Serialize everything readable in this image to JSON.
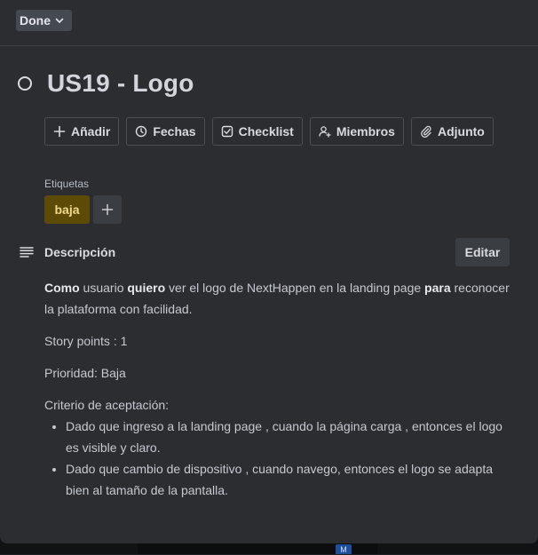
{
  "status": {
    "label": "Done"
  },
  "card": {
    "title": "US19 - Logo"
  },
  "actions": [
    {
      "label": "Añadir",
      "icon": "plus-icon"
    },
    {
      "label": "Fechas",
      "icon": "clock-icon"
    },
    {
      "label": "Checklist",
      "icon": "checkbox-icon"
    },
    {
      "label": "Miembros",
      "icon": "add-member-icon"
    },
    {
      "label": "Adjunto",
      "icon": "paperclip-icon"
    }
  ],
  "labels": {
    "heading": "Etiquetas",
    "items": [
      {
        "text": "baja",
        "color": "#5e4a07"
      }
    ]
  },
  "description": {
    "heading": "Descripción",
    "edit_label": "Editar",
    "intro": {
      "w1": "Como",
      "t1": " usuario ",
      "w2": "quiero",
      "t2": " ver el logo de NextHappen en la landing page ",
      "w3": "para",
      "t3": " reconocer la plataforma con facilidad."
    },
    "story_points": "Story points : 1",
    "priority": "Prioridad: Baja",
    "criteria_heading": "Criterio de aceptación:",
    "criteria": [
      "Dado que ingreso a la landing page , cuando la página carga , entonces el logo es visible y claro.",
      "Dado que cambio de dispositivo , cuando navego, entonces el logo se adapta bien al tamaño de la pantalla."
    ]
  },
  "backdrop": {
    "avatar_initial": "M"
  }
}
